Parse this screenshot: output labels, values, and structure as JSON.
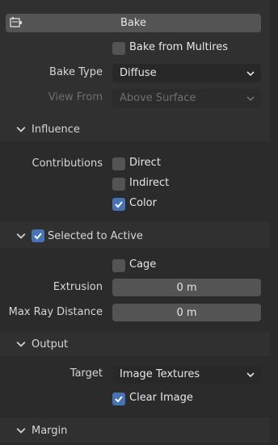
{
  "bake": {
    "button_label": "Bake",
    "bake_from_multires": {
      "label": "Bake from Multires",
      "checked": false
    },
    "bake_type": {
      "label": "Bake Type",
      "value": "Diffuse"
    },
    "view_from": {
      "label": "View From",
      "value": "Above Surface",
      "disabled": true
    }
  },
  "influence": {
    "title": "Influence",
    "contributions_label": "Contributions",
    "items": [
      {
        "label": "Direct",
        "checked": false
      },
      {
        "label": "Indirect",
        "checked": false
      },
      {
        "label": "Color",
        "checked": true
      }
    ]
  },
  "selected_to_active": {
    "title": "Selected to Active",
    "checked": true,
    "cage": {
      "label": "Cage",
      "checked": false
    },
    "extrusion": {
      "label": "Extrusion",
      "value": "0 m"
    },
    "max_ray_distance": {
      "label": "Max Ray Distance",
      "value": "0 m"
    }
  },
  "output": {
    "title": "Output",
    "target": {
      "label": "Target",
      "value": "Image Textures"
    },
    "clear_image": {
      "label": "Clear Image",
      "checked": true
    }
  },
  "margin": {
    "title": "Margin"
  },
  "colors": {
    "accent": "#4772b3",
    "panel_bg": "#303030",
    "button_bg": "#545454"
  },
  "icons": [
    "bake-icon",
    "chevron-down-icon",
    "check-icon"
  ]
}
